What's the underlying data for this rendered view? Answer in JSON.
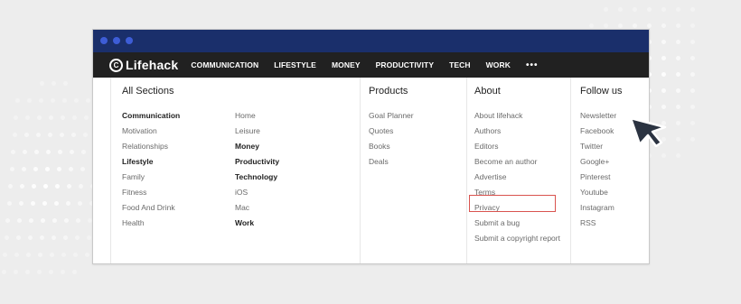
{
  "nav": {
    "logo_text": "Lifehack",
    "items": [
      "COMMUNICATION",
      "LIFESTYLE",
      "MONEY",
      "PRODUCTIVITY",
      "TECH",
      "WORK"
    ],
    "more": "•••"
  },
  "menu": {
    "all_sections": {
      "heading": "All Sections",
      "col1": [
        "Communication",
        "Motivation",
        "Relationships",
        "Lifestyle",
        "Family",
        "Fitness",
        "Food And Drink",
        "Health"
      ],
      "col2": [
        "Home",
        "Leisure",
        "Money",
        "Productivity",
        "Technology",
        "iOS",
        "Mac",
        "Work"
      ]
    },
    "products": {
      "heading": "Products",
      "items": [
        "Goal Planner",
        "Quotes",
        "Books",
        "Deals"
      ]
    },
    "about": {
      "heading": "About",
      "items": [
        "About lifehack",
        "Authors",
        "Editors",
        "Become an author",
        "Advertise",
        "Terms",
        "Privacy",
        "Submit a bug",
        "Submit a copyright report"
      ]
    },
    "follow": {
      "heading": "Follow us",
      "items": [
        "Newsletter",
        "Facebook",
        "Twitter",
        "Google+",
        "Pinterest",
        "Youtube",
        "Instagram",
        "RSS"
      ]
    }
  },
  "colors": {
    "titlebar": "#1a2f6b",
    "navbar": "#212121",
    "highlight": "#d9534f",
    "cursor": "#2b3341"
  }
}
